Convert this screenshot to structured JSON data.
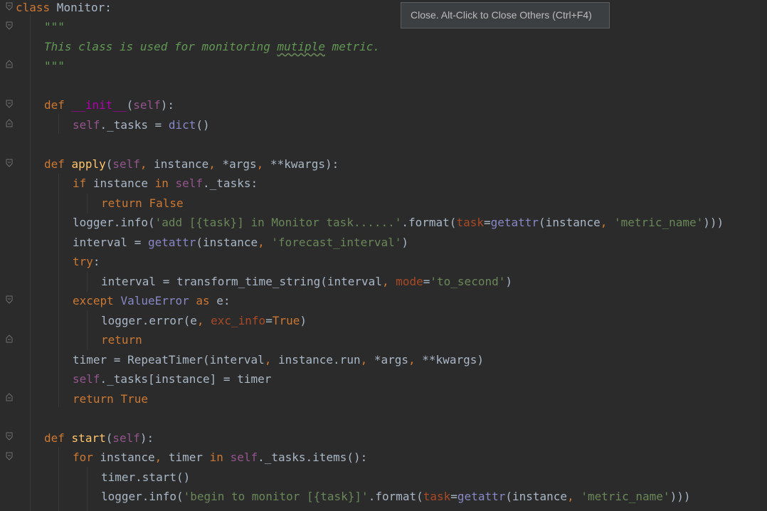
{
  "tooltip": {
    "text": "Close. Alt-Click to Close Others (Ctrl+F4)"
  },
  "colors": {
    "background": "#2b2b2b",
    "keyword": "#cc7832",
    "self": "#94558d",
    "function": "#ffc66d",
    "builtin": "#8888c6",
    "string": "#6a8759",
    "docstring": "#629755",
    "param": "#aa4926",
    "magic": "#b200b2",
    "text": "#a9b7c6"
  },
  "code": {
    "l1": [
      "class",
      " Monitor:"
    ],
    "l2": [
      "\"\"\""
    ],
    "l3": [
      "This class is used for monitoring ",
      "mutiple",
      " metric."
    ],
    "l4": [
      "\"\"\""
    ],
    "l5": [
      "def",
      " ",
      "__init__",
      "(",
      "self",
      "):"
    ],
    "l6": [
      "self",
      "._tasks = ",
      "dict",
      "()"
    ],
    "l7": [
      "def",
      " ",
      "apply",
      "(",
      "self",
      ", ",
      "instance",
      ", ",
      "*args",
      ", ",
      "**kwargs",
      "):"
    ],
    "l8": [
      "if",
      " instance ",
      "in",
      " ",
      "self",
      "._tasks:"
    ],
    "l9": [
      "return",
      " ",
      "False"
    ],
    "l10": [
      "logger.info(",
      "'add [{task}] in Monitor task......'",
      ".format(",
      "task",
      "=",
      "getattr",
      "(instance",
      ", ",
      "'metric_name'",
      ")))"
    ],
    "l11": [
      "interval = ",
      "getattr",
      "(instance",
      ", ",
      "'forecast_interval'",
      ")"
    ],
    "l12": [
      "try",
      ":"
    ],
    "l13": [
      "interval = transform_time_string(interval",
      ", ",
      "mode",
      "=",
      "'to_second'",
      ")"
    ],
    "l14": [
      "except",
      " ",
      "ValueError",
      " ",
      "as",
      " e:"
    ],
    "l15": [
      "logger.error(e",
      ", ",
      "exc_info",
      "=",
      "True",
      ")"
    ],
    "l16": [
      "return"
    ],
    "l17": [
      "timer = RepeatTimer(interval",
      ", ",
      "instance.run",
      ", ",
      "*args",
      ", ",
      "**kwargs",
      ")"
    ],
    "l18": [
      "self",
      "._tasks[instance] = timer"
    ],
    "l19": [
      "return",
      " ",
      "True"
    ],
    "l20": [
      "def",
      " ",
      "start",
      "(",
      "self",
      "):"
    ],
    "l21": [
      "for",
      " instance",
      ", ",
      "timer ",
      "in",
      " ",
      "self",
      "._tasks.items():"
    ],
    "l22": [
      "timer.start()"
    ],
    "l23": [
      "logger.info(",
      "'begin to monitor [{task}]'",
      ".format(",
      "task",
      "=",
      "getattr",
      "(instance",
      ", ",
      "'metric_name'",
      ")))"
    ]
  }
}
